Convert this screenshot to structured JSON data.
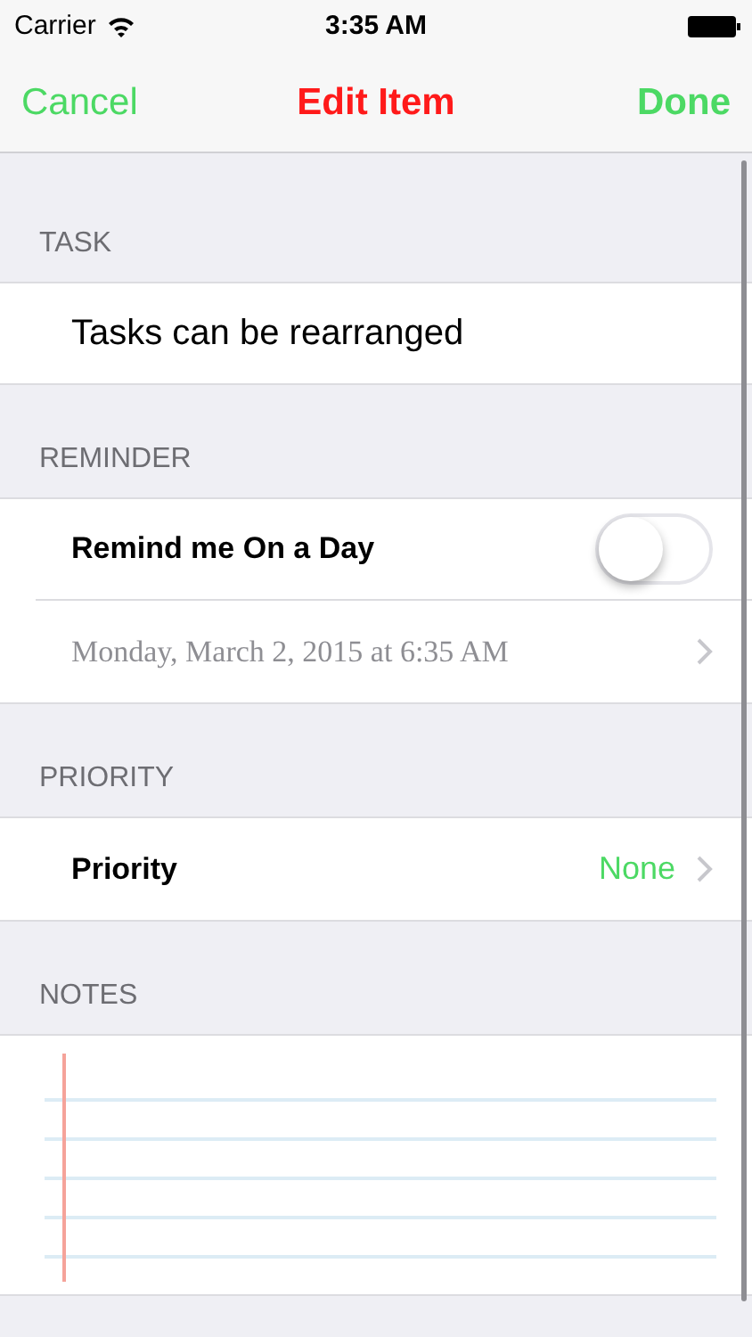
{
  "status_bar": {
    "carrier": "Carrier",
    "time": "3:35 AM"
  },
  "nav_bar": {
    "cancel": "Cancel",
    "title": "Edit Item",
    "done": "Done"
  },
  "sections": [
    {
      "header": "TASK",
      "rows": [
        {
          "kind": "text",
          "label": "Tasks can be rearranged"
        }
      ]
    },
    {
      "header": "REMINDER",
      "rows": [
        {
          "kind": "toggle",
          "label": "Remind me On a Day",
          "on": false
        },
        {
          "kind": "disclosure",
          "label": "Monday, March 2, 2015 at 6:35 AM"
        }
      ]
    },
    {
      "header": "PRIORITY",
      "rows": [
        {
          "kind": "value",
          "label": "Priority",
          "value": "None"
        }
      ]
    },
    {
      "header": "NOTES",
      "rows": [
        {
          "kind": "notes"
        }
      ]
    }
  ]
}
